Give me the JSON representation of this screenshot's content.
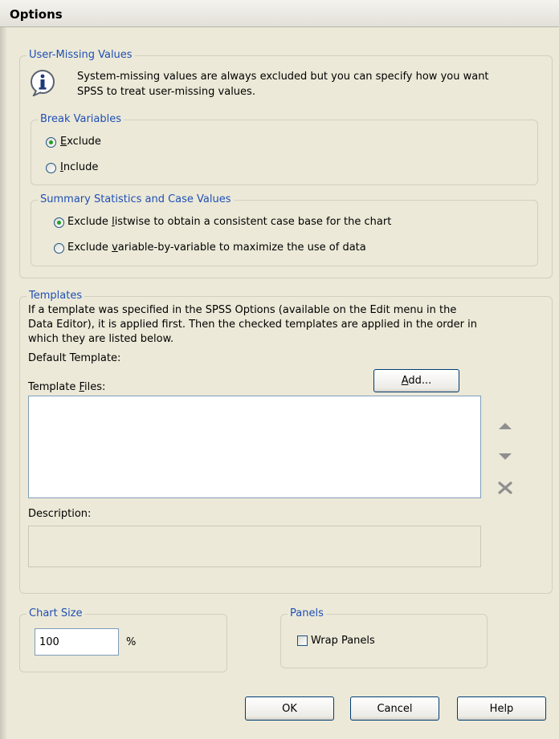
{
  "window": {
    "title": "Options"
  },
  "user_missing": {
    "legend": "User-Missing Values",
    "info_text_line1": "System-missing values are always excluded but you can specify how you want",
    "info_text_line2": "SPSS to treat user-missing values.",
    "info_icon": "info-icon",
    "break_variables": {
      "legend": "Break Variables",
      "options": [
        {
          "label": "Exclude",
          "checked": true
        },
        {
          "label": "Include",
          "checked": false
        }
      ]
    },
    "summary_stats": {
      "legend": "Summary Statistics and Case Values",
      "options": [
        {
          "label": "Exclude listwise to obtain a consistent case base for the chart",
          "checked": true
        },
        {
          "label": "Exclude variable-by-variable to maximize the use of data",
          "checked": false
        }
      ]
    }
  },
  "templates": {
    "legend": "Templates",
    "description_line1": "If a template was specified in the SPSS Options (available on the Edit menu in the",
    "description_line2": "Data Editor), it is applied first. Then the checked templates are applied in the order in",
    "description_line3": "which they are listed below.",
    "default_template_label": "Default Template:",
    "template_files_label": "Template Files:",
    "add_button": "Add...",
    "description_label": "Description:",
    "icons": {
      "move_up": "arrow-up-icon",
      "move_down": "arrow-down-icon",
      "remove": "delete-x-icon"
    }
  },
  "chart_size": {
    "legend": "Chart Size",
    "value": "100",
    "unit": "%"
  },
  "panels": {
    "legend": "Panels",
    "wrap_label": "Wrap Panels",
    "wrap_checked": false
  },
  "buttons": {
    "ok": "OK",
    "cancel": "Cancel",
    "help": "Help"
  },
  "colors": {
    "legend_blue": "#1f4fb5",
    "dialog_bg": "#ece9d8",
    "radio_dot": "#21a121"
  }
}
